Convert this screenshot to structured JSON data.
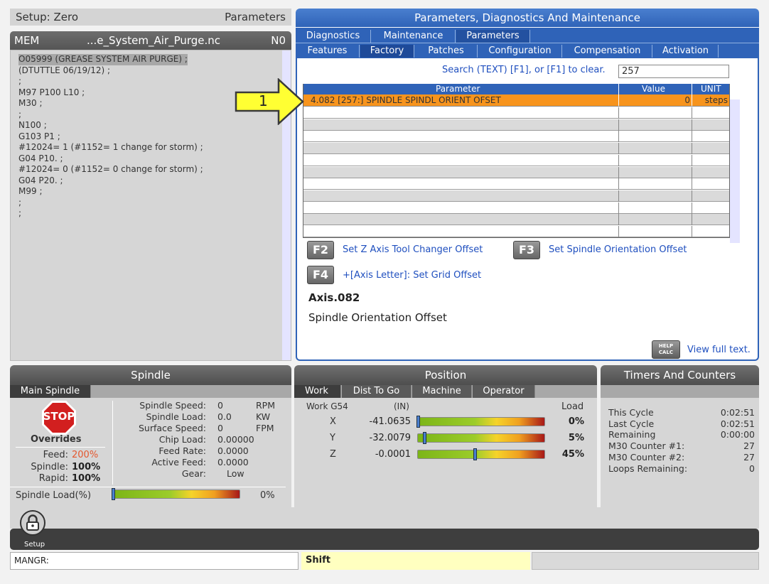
{
  "left_panel": {
    "setup_label": "Setup: Zero",
    "parameters_label": "Parameters",
    "program_header": {
      "mem": "MEM",
      "filename": "...e_System_Air_Purge.nc",
      "n": "N0"
    },
    "program_lines": [
      "O05999 (GREASE SYSTEM AIR PURGE) ;",
      "(DTUTTLE 06/19/12) ;",
      ";",
      "M97 P100 L10 ;",
      "M30 ;",
      ";",
      "N100 ;",
      "G103 P1 ;",
      "#12024= 1 (#1152= 1 change for storm) ;",
      "G04 P10. ;",
      "#12024= 0 (#1152= 0 change for storm) ;",
      "G04 P20. ;",
      "M99 ;",
      ";",
      ";"
    ]
  },
  "callout": {
    "number": "1"
  },
  "right_panel": {
    "title": "Parameters, Diagnostics And Maintenance",
    "tabs_row1": [
      "Diagnostics",
      "Maintenance",
      "Parameters"
    ],
    "tabs_row2": [
      "Features",
      "Factory",
      "Patches",
      "Configuration",
      "Compensation",
      "Activation"
    ],
    "search_label": "Search (TEXT) [F1], or [F1] to clear.",
    "search_value": "257",
    "table": {
      "headers": [
        "Parameter",
        "Value",
        "UNIT"
      ],
      "selected_row": {
        "parameter": "4.082 [257:]  SPINDLE SPINDL ORIENT OFSET",
        "value": "0",
        "unit": "steps"
      }
    },
    "fkeys": {
      "f2": "F2",
      "f2_text": "Set Z Axis Tool Changer Offset",
      "f3": "F3",
      "f3_text": "Set Spindle Orientation Offset",
      "f4": "F4",
      "f4_text": "+[Axis Letter]: Set Grid Offset"
    },
    "axis_title": "Axis.082",
    "axis_desc": "Spindle Orientation Offset",
    "help_icon": {
      "line1": "HELP",
      "line2": "CALC"
    },
    "view_full": "View full text."
  },
  "spindle": {
    "title": "Spindle",
    "subtab": "Main Spindle",
    "stop": "STOP",
    "overrides": "Overrides",
    "feed_label": "Feed:",
    "feed_val": "200%",
    "spindle_label": "Spindle:",
    "spindle_val": "100%",
    "rapid_label": "Rapid:",
    "rapid_val": "100%",
    "rows": [
      {
        "label": "Spindle Speed:",
        "value": "0",
        "unit": "RPM"
      },
      {
        "label": "Spindle Load:",
        "value": "0.0",
        "unit": "KW"
      },
      {
        "label": "Surface Speed:",
        "value": "0",
        "unit": "FPM"
      },
      {
        "label": "Chip Load:",
        "value": "0.00000",
        "unit": ""
      },
      {
        "label": "Feed Rate:",
        "value": "0.0000",
        "unit": ""
      },
      {
        "label": "Active Feed:",
        "value": "0.0000",
        "unit": ""
      },
      {
        "label": "Gear:",
        "value": "Low",
        "unit": ""
      }
    ],
    "load_label": "Spindle Load(%)",
    "load_val": "0%",
    "load_fraction": 0
  },
  "position": {
    "title": "Position",
    "tabs": [
      "Work",
      "Dist To Go",
      "Machine",
      "Operator"
    ],
    "work_label": "Work G54",
    "unit": "(IN)",
    "load_label": "Load",
    "axes": [
      {
        "axis": "X",
        "value": "-41.0635",
        "load": "0%",
        "fraction": 0.0
      },
      {
        "axis": "Y",
        "value": "-32.0079",
        "load": "5%",
        "fraction": 0.05
      },
      {
        "axis": "Z",
        "value": "-0.0001",
        "load": "45%",
        "fraction": 0.45
      }
    ]
  },
  "timers": {
    "title": "Timers And Counters",
    "rows": [
      {
        "label": "This Cycle",
        "value": "0:02:51"
      },
      {
        "label": "Last Cycle",
        "value": "0:02:51"
      },
      {
        "label": "Remaining",
        "value": "0:00:00"
      },
      {
        "label": "M30 Counter #1:",
        "value": "27"
      },
      {
        "label": "M30 Counter #2:",
        "value": "27"
      },
      {
        "label": "Loops Remaining:",
        "value": "0"
      }
    ]
  },
  "bottom": {
    "setup_label": "Setup",
    "mangr": "MANGR:",
    "shift": "Shift"
  },
  "colors": {
    "accent_blue": "#2f63b8",
    "selected_row": "#f7941d",
    "callout_yellow": "#ffff33"
  }
}
